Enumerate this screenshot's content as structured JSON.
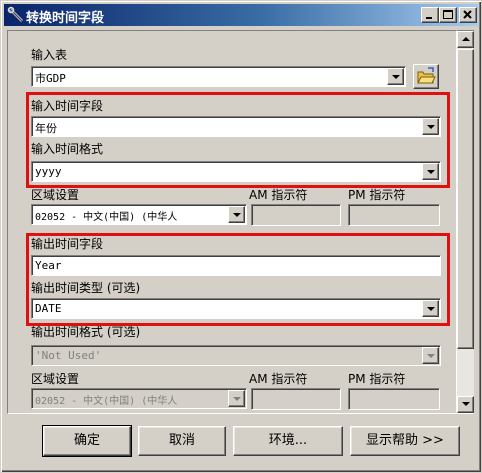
{
  "window": {
    "title": "转换时间字段",
    "controls": {
      "minimize": "_",
      "maximize": "□",
      "close": "×"
    }
  },
  "form": {
    "input_table": {
      "label": "输入表",
      "value": "市GDP"
    },
    "input_time_field": {
      "label": "输入时间字段",
      "value": "年份"
    },
    "input_time_format": {
      "label": "输入时间格式",
      "value": "yyyy"
    },
    "locale_1": {
      "label": "区域设置",
      "value": "02052 - 中文(中国) (中华人"
    },
    "am_designator_1": {
      "label": "AM 指示符"
    },
    "pm_designator_1": {
      "label": "PM 指示符"
    },
    "output_time_field": {
      "label": "输出时间字段",
      "value": "Year"
    },
    "output_time_type": {
      "label": "输出时间类型 (可选)",
      "value": "DATE"
    },
    "output_time_format": {
      "label": "输出时间格式 (可选)",
      "value": "'Not Used'"
    },
    "locale_2": {
      "label": "区域设置",
      "value": "02052 - 中文(中国) (中华人"
    },
    "am_designator_2": {
      "label": "AM 指示符"
    },
    "pm_designator_2": {
      "label": "PM 指示符"
    }
  },
  "buttons": {
    "ok": "确定",
    "cancel": "取消",
    "environments": "环境...",
    "show_help": "显示帮助 >>"
  },
  "colors": {
    "title_gradient_start": "#0a246a",
    "highlight_border": "#e01010",
    "face": "#d4d0c8"
  },
  "icons": [
    "wrench-icon",
    "folder-open-icon",
    "dropdown-arrow-icon",
    "scroll-up-icon",
    "scroll-down-icon"
  ]
}
